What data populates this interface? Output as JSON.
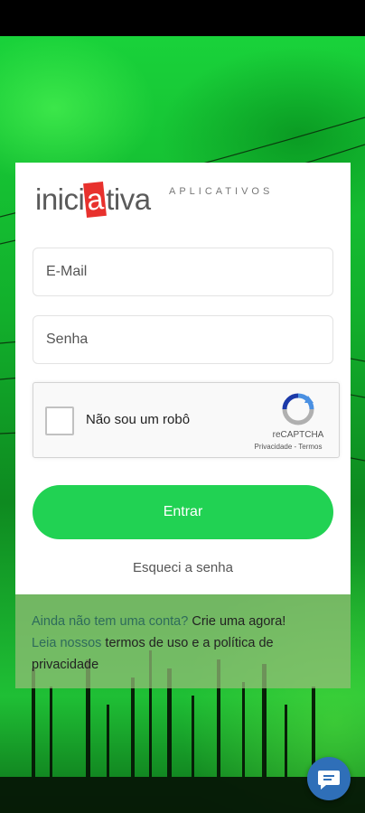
{
  "logo": {
    "main_pre": "inici",
    "main_hl": "a",
    "main_post": "tiva",
    "sub": "APLICATIVOS"
  },
  "form": {
    "email_placeholder": "E-Mail",
    "password_placeholder": "Senha"
  },
  "recaptcha": {
    "label": "Não sou um robô",
    "brand": "reCAPTCHA",
    "links": "Privacidade - Termos"
  },
  "actions": {
    "submit_label": "Entrar",
    "forgot_label": "Esqueci a senha"
  },
  "footer": {
    "signup_prompt": "Ainda não tem uma conta?",
    "signup_link": "Crie uma agora!",
    "terms_prompt": "Leia nossos",
    "terms_link": "termos de uso e a política de privacidade"
  },
  "colors": {
    "accent": "#21d253",
    "logo_highlight": "#e8312d",
    "chat_button": "#2f6fb8"
  },
  "icons": {
    "recaptcha": "recaptcha-icon",
    "chat": "chat-icon"
  }
}
